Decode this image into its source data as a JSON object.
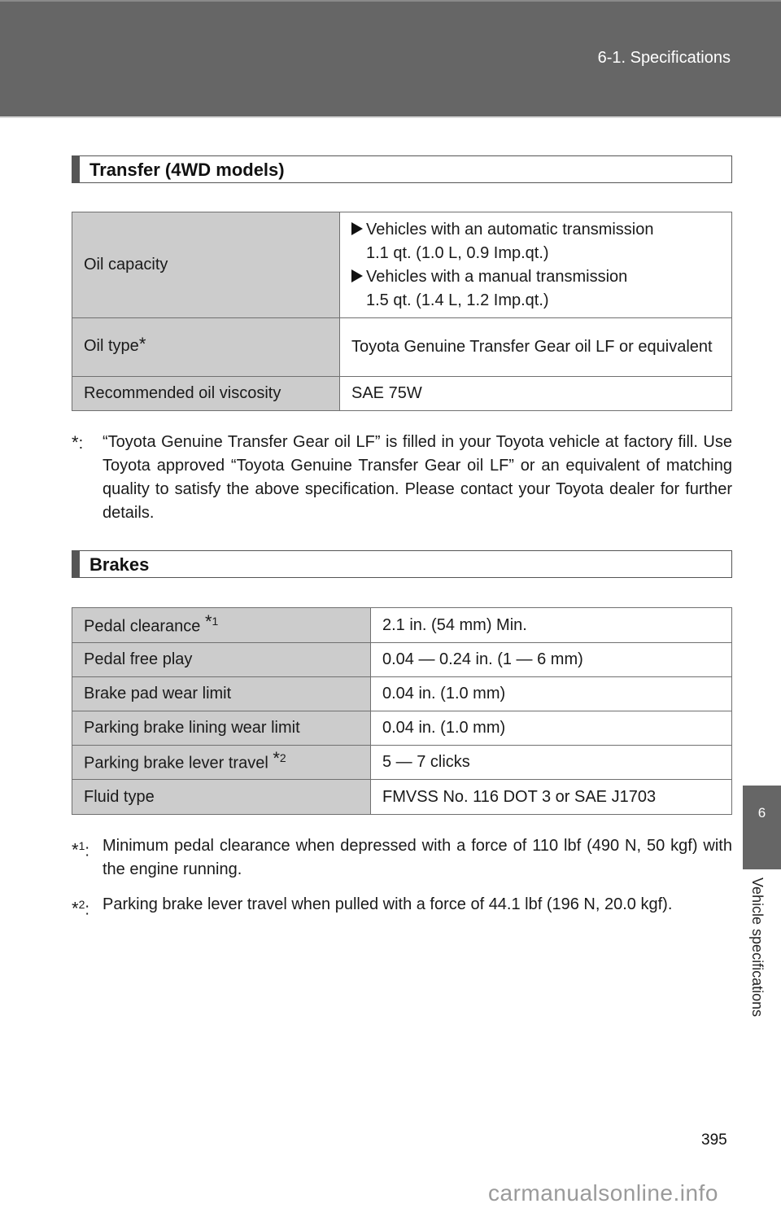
{
  "header": {
    "section_title": "6-1. Specifications"
  },
  "transfer": {
    "title": "Transfer (4WD models)",
    "rows": [
      {
        "label": "Oil capacity",
        "items": [
          {
            "heading": "Vehicles with an automatic transmission",
            "value": "1.1 qt. (1.0 L, 0.9 Imp.qt.)"
          },
          {
            "heading": "Vehicles with a manual transmission",
            "value": "1.5 qt. (1.4 L, 1.2 Imp.qt.)"
          }
        ]
      },
      {
        "label": "Oil type",
        "mark": "*",
        "value": "Toyota Genuine Transfer Gear oil LF or equivalent"
      },
      {
        "label": "Recommended oil viscosity",
        "value": "SAE 75W"
      }
    ],
    "footnote": {
      "mark": "*",
      "text": "“Toyota Genuine Transfer Gear oil LF” is filled in your Toyota vehicle at factory fill. Use Toyota approved “Toyota Genuine Transfer Gear oil LF” or an equivalent of matching quality to satisfy the above specification. Please contact your Toyota dealer for further details."
    }
  },
  "brakes": {
    "title": "Brakes",
    "rows": [
      {
        "label": "Pedal clearance ",
        "mark": "*",
        "sup": "1",
        "value": "2.1 in. (54 mm) Min."
      },
      {
        "label": "Pedal free play",
        "value": "0.04 — 0.24 in. (1 — 6 mm)"
      },
      {
        "label": "Brake pad wear limit",
        "value": "0.04 in. (1.0 mm)"
      },
      {
        "label": "Parking brake lining wear limit",
        "value": "0.04 in. (1.0 mm)"
      },
      {
        "label": "Parking brake lever travel ",
        "mark": "*",
        "sup": "2",
        "value": "5 — 7 clicks"
      },
      {
        "label": "Fluid type",
        "value": "FMVSS No. 116 DOT 3 or SAE J1703"
      }
    ],
    "footnotes": [
      {
        "mark": "*",
        "sup": "1",
        "text": "Minimum pedal clearance when depressed with a force of 110 lbf (490 N, 50 kgf) with the engine running."
      },
      {
        "mark": "*",
        "sup": "2",
        "text": "Parking brake lever travel when pulled with a force of 44.1 lbf (196 N, 20.0 kgf)."
      }
    ]
  },
  "side_tab": {
    "number": "6",
    "label": "Vehicle specifications"
  },
  "page_number": "395",
  "watermark": "carmanualsonline.info"
}
